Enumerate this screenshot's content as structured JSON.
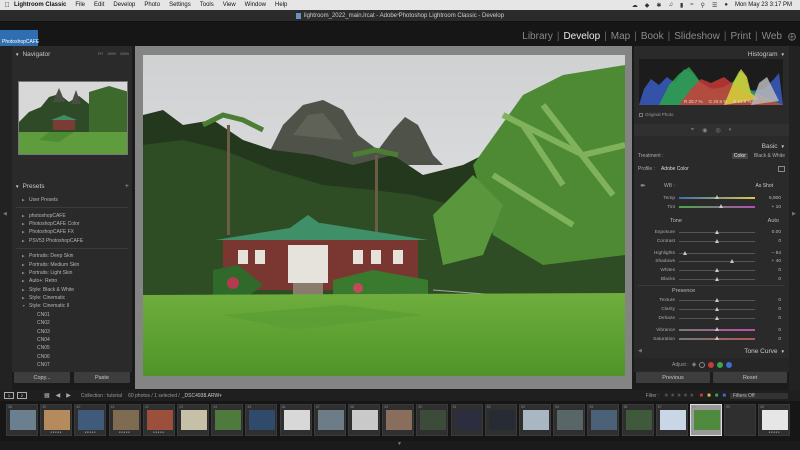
{
  "menubar": {
    "apple": "",
    "items": [
      "Lightroom Classic",
      "File",
      "Edit",
      "Develop",
      "Photo",
      "Settings",
      "Tools",
      "View",
      "Window",
      "Help"
    ],
    "datetime": "Mon May 23  3:17 PM"
  },
  "window": {
    "title": "lightroom_2022_main.lrcat - Adobe Photoshop Lightroom Classic - Develop"
  },
  "identity_plate": "PhotoshopCAFE",
  "modules": {
    "items": [
      "Library",
      "Develop",
      "Map",
      "Book",
      "Slideshow",
      "Print",
      "Web"
    ],
    "active": "Develop"
  },
  "navigator": {
    "title": "Navigator",
    "zoom": [
      "FIT",
      "100%",
      "300%"
    ]
  },
  "presets": {
    "title": "Presets",
    "items": [
      "User Presets",
      "photoshopCAFE",
      "PhotoshopCAFE Color",
      "PhotoshopCAFE FX",
      "PSV53 PhotoshopCAFE",
      "Portraits: Deep Skin",
      "Portraits: Medium Skin",
      "Portraits: Light Skin",
      "Auto+: Retro",
      "Style: Black & White",
      "Style: Cinematic",
      "Style: Cinematic II"
    ],
    "children": [
      "CN01",
      "CN02",
      "CN03",
      "CN04",
      "CN05",
      "CN06",
      "CN07"
    ]
  },
  "left_buttons": {
    "copy": "Copy...",
    "paste": "Paste"
  },
  "right_buttons": {
    "previous": "Previous",
    "reset": "Reset"
  },
  "histogram": {
    "title": "Histogram",
    "readout": [
      "R 20.7 %",
      "G 20.5 %",
      "B 13.9 %"
    ],
    "original_photo": "Original Photo"
  },
  "basic": {
    "title": "Basic",
    "treatment_label": "Treatment :",
    "treatment_options": [
      "Color",
      "Black & White"
    ],
    "treatment_selected": "Color",
    "profile_label": "Profile :",
    "profile_value": "Adobe Color",
    "wb_label": "WB :",
    "wb_value": "As Shot",
    "tone_label": "Tone",
    "auto": "Auto",
    "presence_label": "Presence",
    "sliders": [
      {
        "label": "Temp",
        "value": "6,900",
        "pos": 0.5
      },
      {
        "label": "Tint",
        "value": "+ 10",
        "pos": 0.55
      },
      {
        "label": "Exposure",
        "value": "0.00",
        "pos": 0.5
      },
      {
        "label": "Contrast",
        "value": "0",
        "pos": 0.5
      },
      {
        "label": "Highlights",
        "value": "− 84",
        "pos": 0.08
      },
      {
        "label": "Shadows",
        "value": "+ 40",
        "pos": 0.7
      },
      {
        "label": "Whites",
        "value": "0",
        "pos": 0.5
      },
      {
        "label": "Blacks",
        "value": "0",
        "pos": 0.5
      },
      {
        "label": "Texture",
        "value": "0",
        "pos": 0.5
      },
      {
        "label": "Clarity",
        "value": "0",
        "pos": 0.5
      },
      {
        "label": "Dehaze",
        "value": "0",
        "pos": 0.5
      },
      {
        "label": "Vibrance",
        "value": "0",
        "pos": 0.5
      },
      {
        "label": "Saturation",
        "value": "0",
        "pos": 0.5
      }
    ]
  },
  "tone_curve": {
    "title": "Tone Curve"
  },
  "adjust": {
    "label": "Adjust :"
  },
  "filmstrip_toolbar": {
    "pages": [
      "1",
      "2"
    ],
    "collection": "Collection : tutorial",
    "count": "60 photos / 1 selected /",
    "filename": "_DSC4938.ARW",
    "filter_label": "Filter :",
    "filter_value": "Filters Off"
  },
  "filmstrip": {
    "numbers": [
      "38",
      "39",
      "40",
      "41",
      "42",
      "43",
      "44",
      "45",
      "46",
      "47",
      "48",
      "49",
      "50",
      "51",
      "52",
      "53",
      "54",
      "55",
      "56",
      "57",
      "58",
      "59",
      "60"
    ],
    "selected_index": 20
  }
}
